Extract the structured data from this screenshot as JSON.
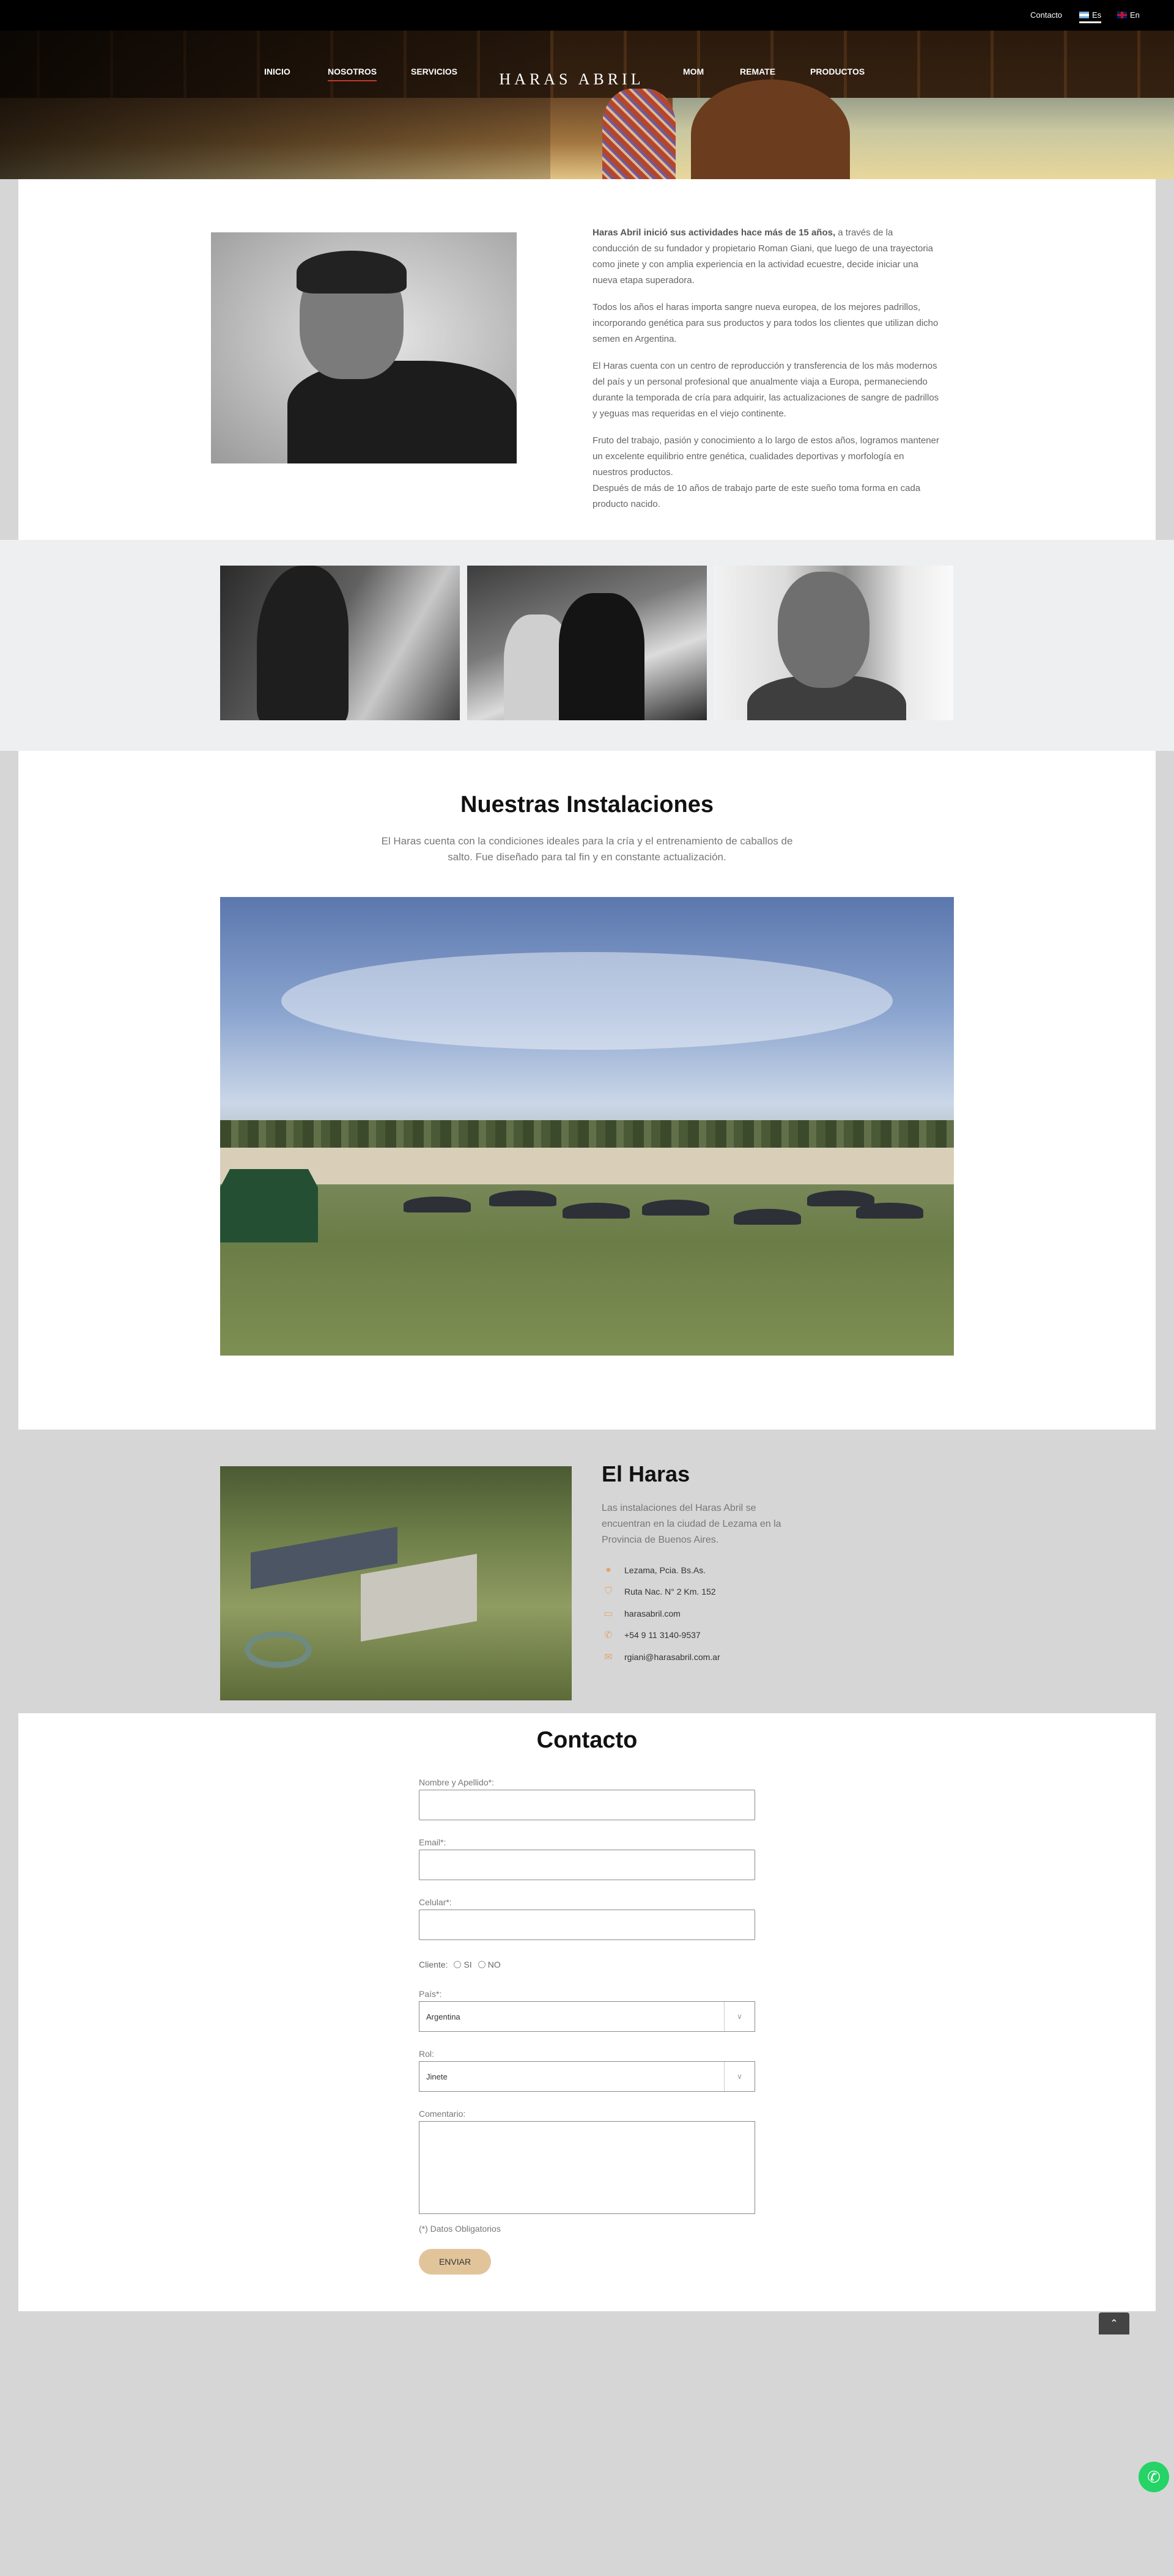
{
  "topbar": {
    "contact": "Contacto",
    "lang_es": "Es",
    "lang_en": "En"
  },
  "nav": {
    "items": [
      "INICIO",
      "NOSOTROS",
      "SERVICIOS",
      "MoM",
      "REMATE",
      "PRODUCTOS"
    ],
    "active": "NOSOTROS",
    "logo": "HARAS ABRIL"
  },
  "about": {
    "p1_bold": "Haras Abril inició sus actividades hace más de 15 años,",
    "p1_rest": " a través de la conducción de su fundador y propietario Roman Giani, que luego de una trayectoria como jinete y con amplia experiencia en la actividad ecuestre, decide iniciar una nueva etapa superadora.",
    "p2": "Todos los años el haras importa sangre nueva europea, de los mejores padrillos, incorporando genética para sus productos y para todos los clientes que utilizan dicho semen en Argentina.",
    "p3": "El Haras cuenta con un centro de reproducción y transferencia de los más modernos del país y un personal profesional que anualmente viaja a Europa, permaneciendo durante la temporada de cría para adquirir, las actualizaciones de sangre de padrillos y yeguas mas requeridas en el viejo continente.",
    "p4a": "Fruto del trabajo, pasión y conocimiento a lo largo de estos años, logramos mantener un excelente equilibrio entre genética, cualidades deportivas y morfología en nuestros productos.",
    "p4b": "Después de más de 10 años de trabajo parte de este sueño toma forma en cada producto nacido."
  },
  "installations": {
    "title": "Nuestras Instalaciones",
    "subtitle": "El Haras cuenta con la condiciones ideales para la cría y el entrenamiento de caballos de salto. Fue diseñado para tal fin y en constante actualización."
  },
  "haras": {
    "title": "El Haras",
    "description": "Las instalaciones del Haras Abril se encuentran en la ciudad de Lezama en la Provincia de Buenos Aires.",
    "location": "Lezama, Pcia. Bs.As.",
    "route": "Ruta Nac. N° 2 Km. 152",
    "website": "harasabril.com",
    "phone": "+54 9 11 3140-9537",
    "email": "rgiani@harasabril.com.ar"
  },
  "contact": {
    "title": "Contacto",
    "name_label": "Nombre y Apellido*:",
    "email_label": "Email*:",
    "cell_label": "Celular*:",
    "client_label": "Cliente:",
    "client_yes": "SI",
    "client_no": "NO",
    "country_label": "País*:",
    "country_value": "Argentina",
    "role_label": "Rol:",
    "role_value": "Jinete",
    "comment_label": "Comentario:",
    "required_note": "(*) Datos Obligatorios",
    "send": "ENVIAR"
  },
  "colors": {
    "accent": "#e2c49b",
    "nav_active_underline": "#c0392b",
    "whatsapp": "#25d366"
  },
  "icons": [
    "map-pin-icon",
    "route-shield-icon",
    "laptop-icon",
    "whatsapp-icon",
    "envelope-icon",
    "chevron-up-icon",
    "chevron-down-icon"
  ]
}
